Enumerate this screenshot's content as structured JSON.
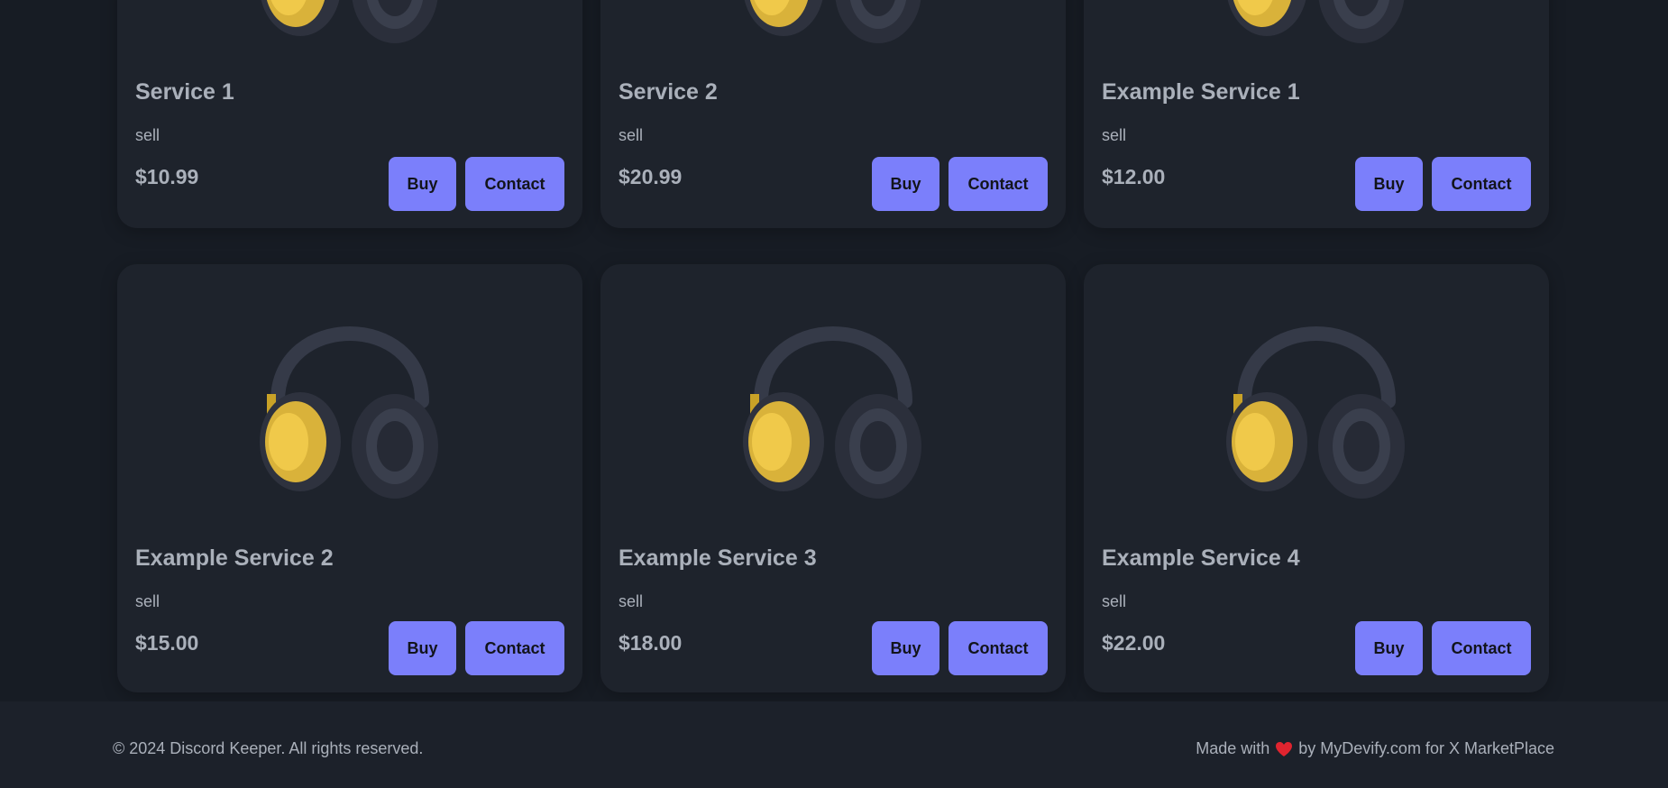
{
  "services": [
    {
      "title": "Service 1",
      "desc": "sell",
      "price": "$10.99",
      "buy": "Buy",
      "contact": "Contact"
    },
    {
      "title": "Service 2",
      "desc": "sell",
      "price": "$20.99",
      "buy": "Buy",
      "contact": "Contact"
    },
    {
      "title": "Example Service 1",
      "desc": "sell",
      "price": "$12.00",
      "buy": "Buy",
      "contact": "Contact"
    },
    {
      "title": "Example Service 2",
      "desc": "sell",
      "price": "$15.00",
      "buy": "Buy",
      "contact": "Contact"
    },
    {
      "title": "Example Service 3",
      "desc": "sell",
      "price": "$18.00",
      "buy": "Buy",
      "contact": "Contact"
    },
    {
      "title": "Example Service 4",
      "desc": "sell",
      "price": "$22.00",
      "buy": "Buy",
      "contact": "Contact"
    }
  ],
  "footer": {
    "copyright": "© 2024 Discord Keeper. All rights reserved.",
    "made_with": "Made with",
    "by_text": "by MyDevify.com for X MarketPlace"
  },
  "colors": {
    "background": "#171c24",
    "card": "#1e232c",
    "accent": "#7b7ffb",
    "text": "#aab0ba"
  },
  "icons": {
    "product_image": "headphones-icon",
    "footer_heart": "heart-icon"
  }
}
